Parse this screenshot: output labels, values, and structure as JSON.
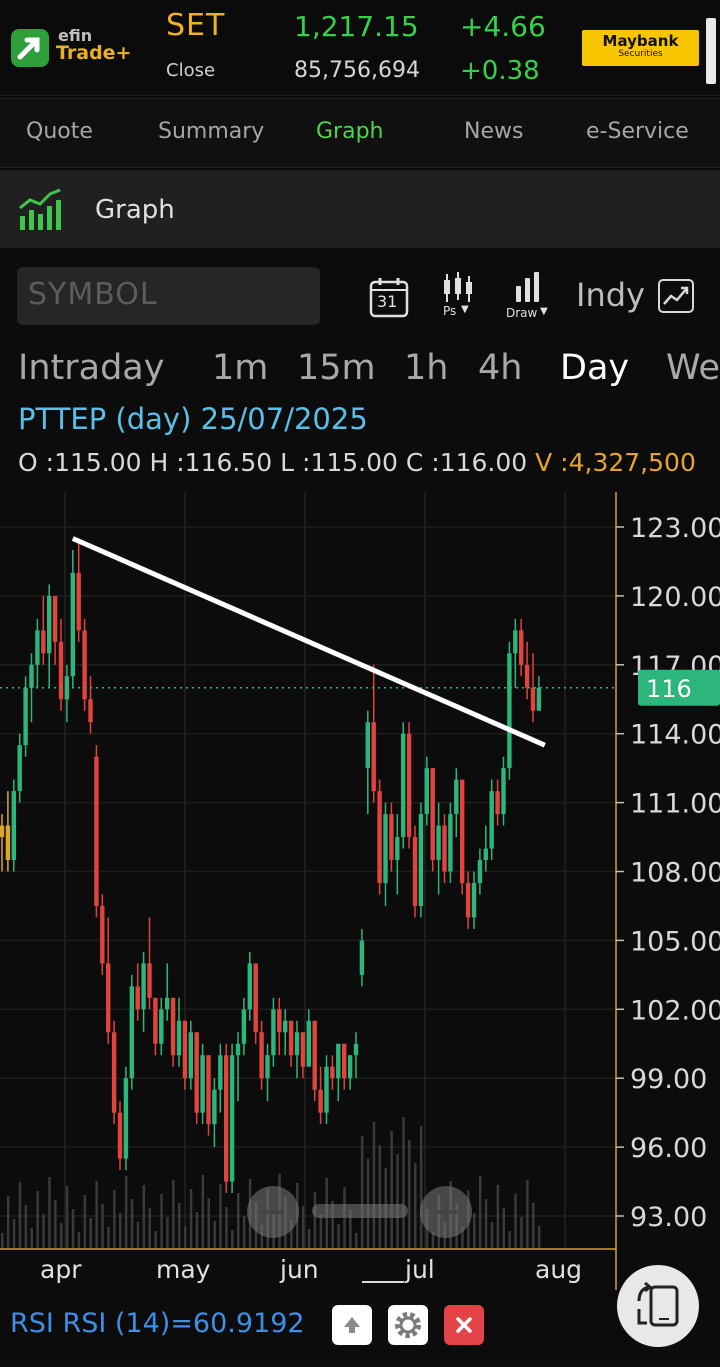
{
  "header": {
    "logo_line1": "efin",
    "logo_line2": "Trade+",
    "index_name": "SET",
    "index_value": "1,217.15",
    "index_change": "+4.66",
    "close_label": "Close",
    "volume": "85,756,694",
    "pct_change": "+0.38",
    "broker_name": "Maybank",
    "broker_sub": "Securities"
  },
  "tabs": [
    "Quote",
    "Summary",
    "Graph",
    "News",
    "e-Service"
  ],
  "active_tab": "Graph",
  "section": {
    "title": "Graph"
  },
  "toolbar": {
    "symbol_placeholder": "SYMBOL",
    "calendar_day": "31",
    "ps_label": "Ps",
    "draw_label": "Draw",
    "indy_label": "Indy"
  },
  "periods": [
    "Intraday",
    "1m",
    "15m",
    "1h",
    "4h",
    "Day",
    "We"
  ],
  "active_period": "Day",
  "info": {
    "title": "PTTEP (day) 25/07/2025",
    "o_label": "O :",
    "o": "115.00",
    "h_label": "H :",
    "h": "116.50",
    "l_label": "L :",
    "l": "115.00",
    "c_label": "C :",
    "c": "116.00",
    "v_label": "V :",
    "v": "4,327,500"
  },
  "chart_data": {
    "type": "candlestick",
    "symbol": "PTTEP",
    "y_ticks": [
      "123.00",
      "120.00",
      "117.00",
      "114.00",
      "111.00",
      "108.00",
      "105.00",
      "102.00",
      "99.00",
      "96.00",
      "93.00"
    ],
    "x_ticks": [
      "apr",
      "may",
      "jun",
      "jul",
      "aug"
    ],
    "last_price_label": "116",
    "last_price": 116,
    "ylim": [
      92,
      124
    ],
    "colors": {
      "up": "#2db67c",
      "down": "#e0443c",
      "neutral": "#e0a52b",
      "trendline": "#ffffff",
      "price_tag": "#2db67c"
    },
    "candles": [
      [
        109.5,
        110.5,
        108.0,
        110.0
      ],
      [
        110.0,
        111.5,
        108.0,
        108.5
      ],
      [
        108.5,
        112.0,
        108.0,
        111.5
      ],
      [
        111.5,
        114.0,
        111.0,
        113.5
      ],
      [
        113.5,
        116.5,
        113.0,
        116.0
      ],
      [
        116.0,
        117.5,
        114.5,
        117.0
      ],
      [
        117.0,
        119.0,
        116.0,
        118.5
      ],
      [
        118.5,
        120.0,
        117.0,
        117.5
      ],
      [
        117.5,
        120.5,
        116.0,
        120.0
      ],
      [
        120.0,
        118.5,
        117.0,
        118.0
      ],
      [
        118.0,
        119.0,
        115.0,
        115.5
      ],
      [
        115.5,
        117.0,
        114.5,
        116.5
      ],
      [
        116.5,
        122.0,
        116.0,
        121.0
      ],
      [
        121.0,
        122.5,
        118.0,
        118.5
      ],
      [
        118.5,
        119.0,
        115.0,
        115.5
      ],
      [
        115.5,
        116.5,
        114.0,
        114.5
      ],
      [
        113.0,
        113.5,
        106.0,
        106.5
      ],
      [
        106.5,
        107.0,
        103.5,
        104.0
      ],
      [
        104.0,
        106.0,
        100.5,
        101.0
      ],
      [
        101.0,
        101.5,
        97.0,
        97.5
      ],
      [
        97.5,
        98.0,
        95.0,
        95.5
      ],
      [
        95.5,
        99.5,
        95.0,
        99.0
      ],
      [
        99.0,
        103.5,
        98.5,
        103.0
      ],
      [
        103.0,
        104.0,
        101.5,
        102.0
      ],
      [
        102.0,
        104.5,
        101.0,
        104.0
      ],
      [
        104.0,
        106.0,
        102.0,
        102.5
      ],
      [
        102.5,
        102.5,
        100.0,
        100.5
      ],
      [
        100.5,
        102.5,
        100.0,
        102.0
      ],
      [
        102.0,
        104.0,
        101.5,
        102.5
      ],
      [
        102.5,
        102.5,
        99.5,
        100.0
      ],
      [
        100.0,
        102.5,
        99.5,
        101.5
      ],
      [
        101.5,
        101.5,
        98.5,
        99.0
      ],
      [
        99.0,
        101.5,
        98.5,
        101.0
      ],
      [
        101.0,
        101.0,
        97.0,
        97.5
      ],
      [
        97.5,
        100.5,
        97.0,
        100.0
      ],
      [
        100.0,
        100.0,
        96.5,
        97.0
      ],
      [
        97.0,
        99.0,
        96.0,
        98.5
      ],
      [
        98.5,
        100.5,
        97.5,
        100.0
      ],
      [
        100.0,
        100.5,
        94.0,
        94.5
      ],
      [
        94.5,
        100.5,
        94.0,
        100.0
      ],
      [
        100.0,
        101.0,
        98.0,
        100.5
      ],
      [
        100.5,
        102.5,
        100.0,
        102.0
      ],
      [
        102.0,
        104.5,
        101.5,
        104.0
      ],
      [
        104.0,
        104.0,
        100.5,
        101.0
      ],
      [
        101.0,
        101.5,
        98.5,
        99.0
      ],
      [
        99.0,
        100.5,
        98.0,
        100.0
      ],
      [
        100.0,
        102.5,
        99.5,
        102.0
      ],
      [
        102.0,
        102.5,
        100.0,
        101.0
      ],
      [
        101.0,
        102.0,
        100.0,
        101.5
      ],
      [
        101.5,
        101.5,
        99.5,
        100.0
      ],
      [
        100.0,
        101.5,
        99.0,
        101.0
      ],
      [
        101.0,
        101.0,
        99.0,
        99.5
      ],
      [
        99.5,
        102.0,
        99.5,
        101.5
      ],
      [
        101.5,
        101.5,
        98.0,
        98.5
      ],
      [
        98.5,
        99.5,
        97.0,
        97.5
      ],
      [
        97.5,
        100.0,
        97.0,
        99.5
      ],
      [
        99.5,
        100.0,
        98.5,
        99.0
      ],
      [
        99.0,
        100.5,
        98.0,
        100.5
      ],
      [
        100.5,
        100.5,
        98.5,
        99.0
      ],
      [
        99.0,
        100.0,
        98.5,
        100.0
      ],
      [
        100.0,
        101.0,
        99.0,
        100.5
      ],
      [
        103.5,
        105.5,
        103.0,
        105.0
      ],
      [
        112.5,
        115.0,
        110.5,
        114.5
      ],
      [
        114.5,
        117.0,
        111.0,
        111.5
      ],
      [
        111.5,
        112.0,
        107.0,
        107.5
      ],
      [
        107.5,
        111.0,
        106.5,
        110.5
      ],
      [
        110.5,
        111.0,
        108.0,
        108.5
      ],
      [
        108.5,
        110.5,
        107.0,
        109.5
      ],
      [
        109.5,
        114.5,
        109.0,
        114.0
      ],
      [
        114.0,
        114.5,
        109.0,
        109.5
      ],
      [
        109.5,
        110.0,
        106.0,
        106.5
      ],
      [
        106.5,
        111.0,
        106.0,
        110.5
      ],
      [
        110.5,
        113.0,
        110.0,
        112.5
      ],
      [
        112.5,
        112.5,
        108.0,
        108.5
      ],
      [
        108.5,
        111.0,
        107.0,
        110.0
      ],
      [
        110.0,
        110.5,
        107.5,
        108.0
      ],
      [
        108.0,
        111.0,
        107.5,
        110.5
      ],
      [
        110.5,
        112.5,
        109.5,
        112.0
      ],
      [
        112.0,
        112.0,
        107.0,
        107.5
      ],
      [
        107.5,
        108.0,
        105.5,
        106.0
      ],
      [
        106.0,
        108.0,
        105.5,
        107.5
      ],
      [
        107.5,
        109.0,
        107.0,
        108.5
      ],
      [
        108.5,
        110.0,
        108.0,
        109.0
      ],
      [
        109.0,
        112.0,
        108.5,
        111.5
      ],
      [
        111.5,
        112.0,
        110.0,
        110.5
      ],
      [
        110.5,
        113.0,
        110.0,
        112.5
      ],
      [
        112.5,
        118.0,
        112.0,
        117.5
      ],
      [
        117.5,
        119.0,
        116.0,
        118.5
      ],
      [
        118.5,
        119.0,
        116.5,
        117.0
      ],
      [
        117.0,
        118.0,
        115.5,
        116.0
      ],
      [
        116.0,
        117.5,
        114.5,
        115.0
      ],
      [
        115.0,
        116.5,
        115.0,
        116.0
      ]
    ],
    "trendline": [
      [
        12,
        122.5
      ],
      [
        92,
        113.5
      ]
    ],
    "rsi_label": "RSI RSI (14)=60.9192"
  }
}
